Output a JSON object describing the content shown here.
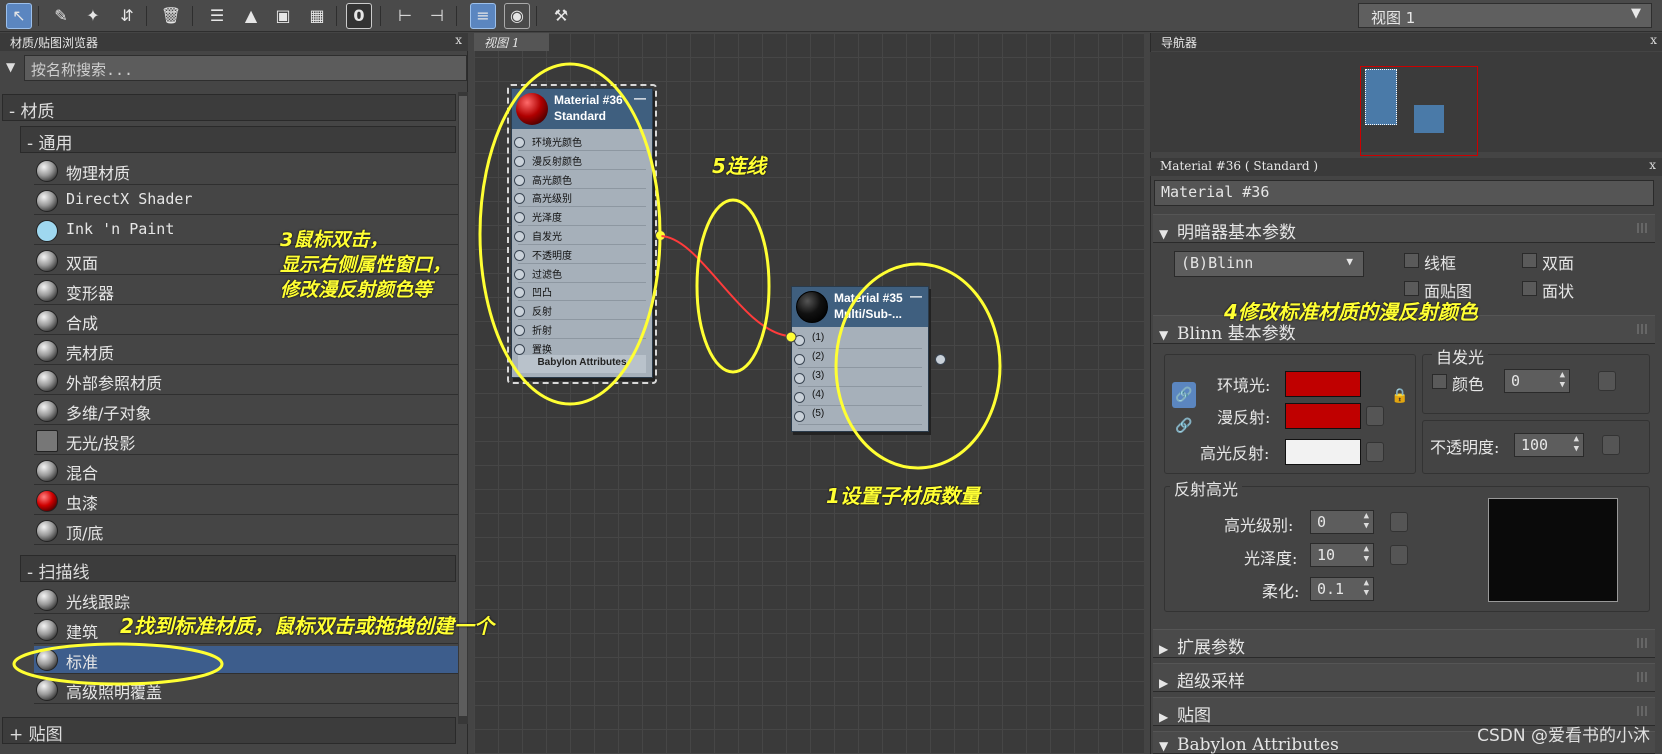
{
  "toolbar": {
    "icons": [
      "select-arrow-icon",
      "eyedropper-icon",
      "paint-brush-icon",
      "node-move-icon",
      "delete-icon",
      "layout-icon",
      "up-arrow-icon",
      "show-map-icon",
      "checker-icon",
      "zero-icon",
      "align-left-icon",
      "align-children-icon",
      "hide-unused-slots-icon",
      "render-preview-icon",
      "navigate-icon"
    ],
    "view_select": "视图 1"
  },
  "left_panel": {
    "title": "材质/贴图浏览器",
    "close": "x",
    "search_placeholder": "按名称搜索...",
    "group_material": "- 材质",
    "subgroup_general": "- 通用",
    "general_items": [
      "物理材质",
      "DirectX Shader",
      "Ink 'n Paint",
      "双面",
      "变形器",
      "合成",
      "壳材质",
      "外部参照材质",
      "多维/子对象",
      "无光/投影",
      "混合",
      "虫漆",
      "顶/底"
    ],
    "subgroup_scanline": "- 扫描线",
    "scanline_items": [
      "光线跟踪",
      "建筑",
      "标准",
      "高级照明覆盖"
    ],
    "group_maps": "+ 贴图"
  },
  "canvas": {
    "tab": "视图 1",
    "node1": {
      "title": "Material #36",
      "subtitle": "Standard",
      "minimize": "—",
      "slots": [
        "环境光颜色",
        "漫反射颜色",
        "高光颜色",
        "高光级别",
        "光泽度",
        "自发光",
        "不透明度",
        "过滤色",
        "凹凸",
        "反射",
        "折射",
        "置换"
      ],
      "footer": "Babylon Attributes"
    },
    "node2": {
      "title": "Material #35",
      "subtitle": "Multi/Sub-...",
      "minimize": "—",
      "slots": [
        "(1)",
        "(2)",
        "(3)",
        "(4)",
        "(5)"
      ]
    }
  },
  "right_panel": {
    "navigator_title": "导航器",
    "props_title": "Material #36  ( Standard )",
    "material_name": "Material #36",
    "rollout_shader": "明暗器基本参数",
    "shader_value": "(B)Blinn",
    "shader_checks": [
      "线框",
      "双面",
      "面贴图",
      "面状"
    ],
    "rollout_blinn": "Blinn 基本参数",
    "self_illum_label": "自发光",
    "self_illum_color": "颜色",
    "self_illum_value": "0",
    "ambient_label": "环境光:",
    "diffuse_label": "漫反射:",
    "specular_label": "高光反射:",
    "opacity_label": "不透明度:",
    "opacity_value": "100",
    "spec_highlights_label": "反射高光",
    "spec_level_label": "高光级别:",
    "spec_level_value": "0",
    "gloss_label": "光泽度:",
    "gloss_value": "10",
    "soften_label": "柔化:",
    "soften_value": "0.1",
    "rollout_extended": "扩展参数",
    "rollout_supersampling": "超级采样",
    "rollout_maps": "贴图",
    "rollout_babylon": "Babylon Attributes"
  },
  "annotations": {
    "a1": "1设置子材质数量",
    "a2": "2找到标准材质，鼠标双击或拖拽创建一个",
    "a3_line1": "3鼠标双击，",
    "a3_line2": "显示右侧属性窗口，",
    "a3_line3": "修改漫反射颜色等",
    "a4": "4修改标准材质的漫反射颜色",
    "a5": "5连线"
  },
  "colors": {
    "ambient": "#c00000",
    "diffuse": "#c00000",
    "specular": "#f2f2f2",
    "annotation": "#ffff33",
    "accent": "#5b86c0"
  },
  "watermark": "CSDN @爱看书的小沐"
}
